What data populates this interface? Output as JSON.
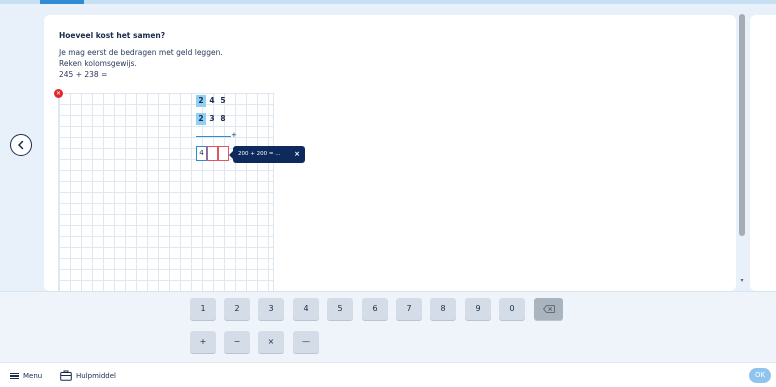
{
  "question": {
    "title": "Hoeveel kost het samen?",
    "line1": "Je mag eerst de bedragen met geld leggen.",
    "line2": "Reken kolomsgewijs.",
    "line3": "245 + 238 ="
  },
  "workspace": {
    "row1": [
      "2",
      "4",
      "5"
    ],
    "row2": [
      "2",
      "3",
      "8"
    ],
    "operator": "+",
    "answer": [
      "4",
      "",
      ""
    ],
    "tooltip": "200 + 200 = ...",
    "tooltip_close": "×"
  },
  "keypad": {
    "digits": [
      "1",
      "2",
      "3",
      "4",
      "5",
      "6",
      "7",
      "8",
      "9",
      "0"
    ],
    "operators": [
      "+",
      "−",
      "×",
      "—"
    ]
  },
  "footer": {
    "menu_label": "Menu",
    "help_label": "Hulpmiddel",
    "ok_label": "OK"
  },
  "colors": {
    "accent": "#2e8bd4",
    "highlight": "#8fd0f5",
    "error": "#e0262e",
    "tooltip_bg": "#0e2a5c"
  },
  "icons": [
    "back-arrow-icon",
    "close-icon",
    "backspace-icon",
    "menu-icon",
    "toolbox-icon"
  ]
}
